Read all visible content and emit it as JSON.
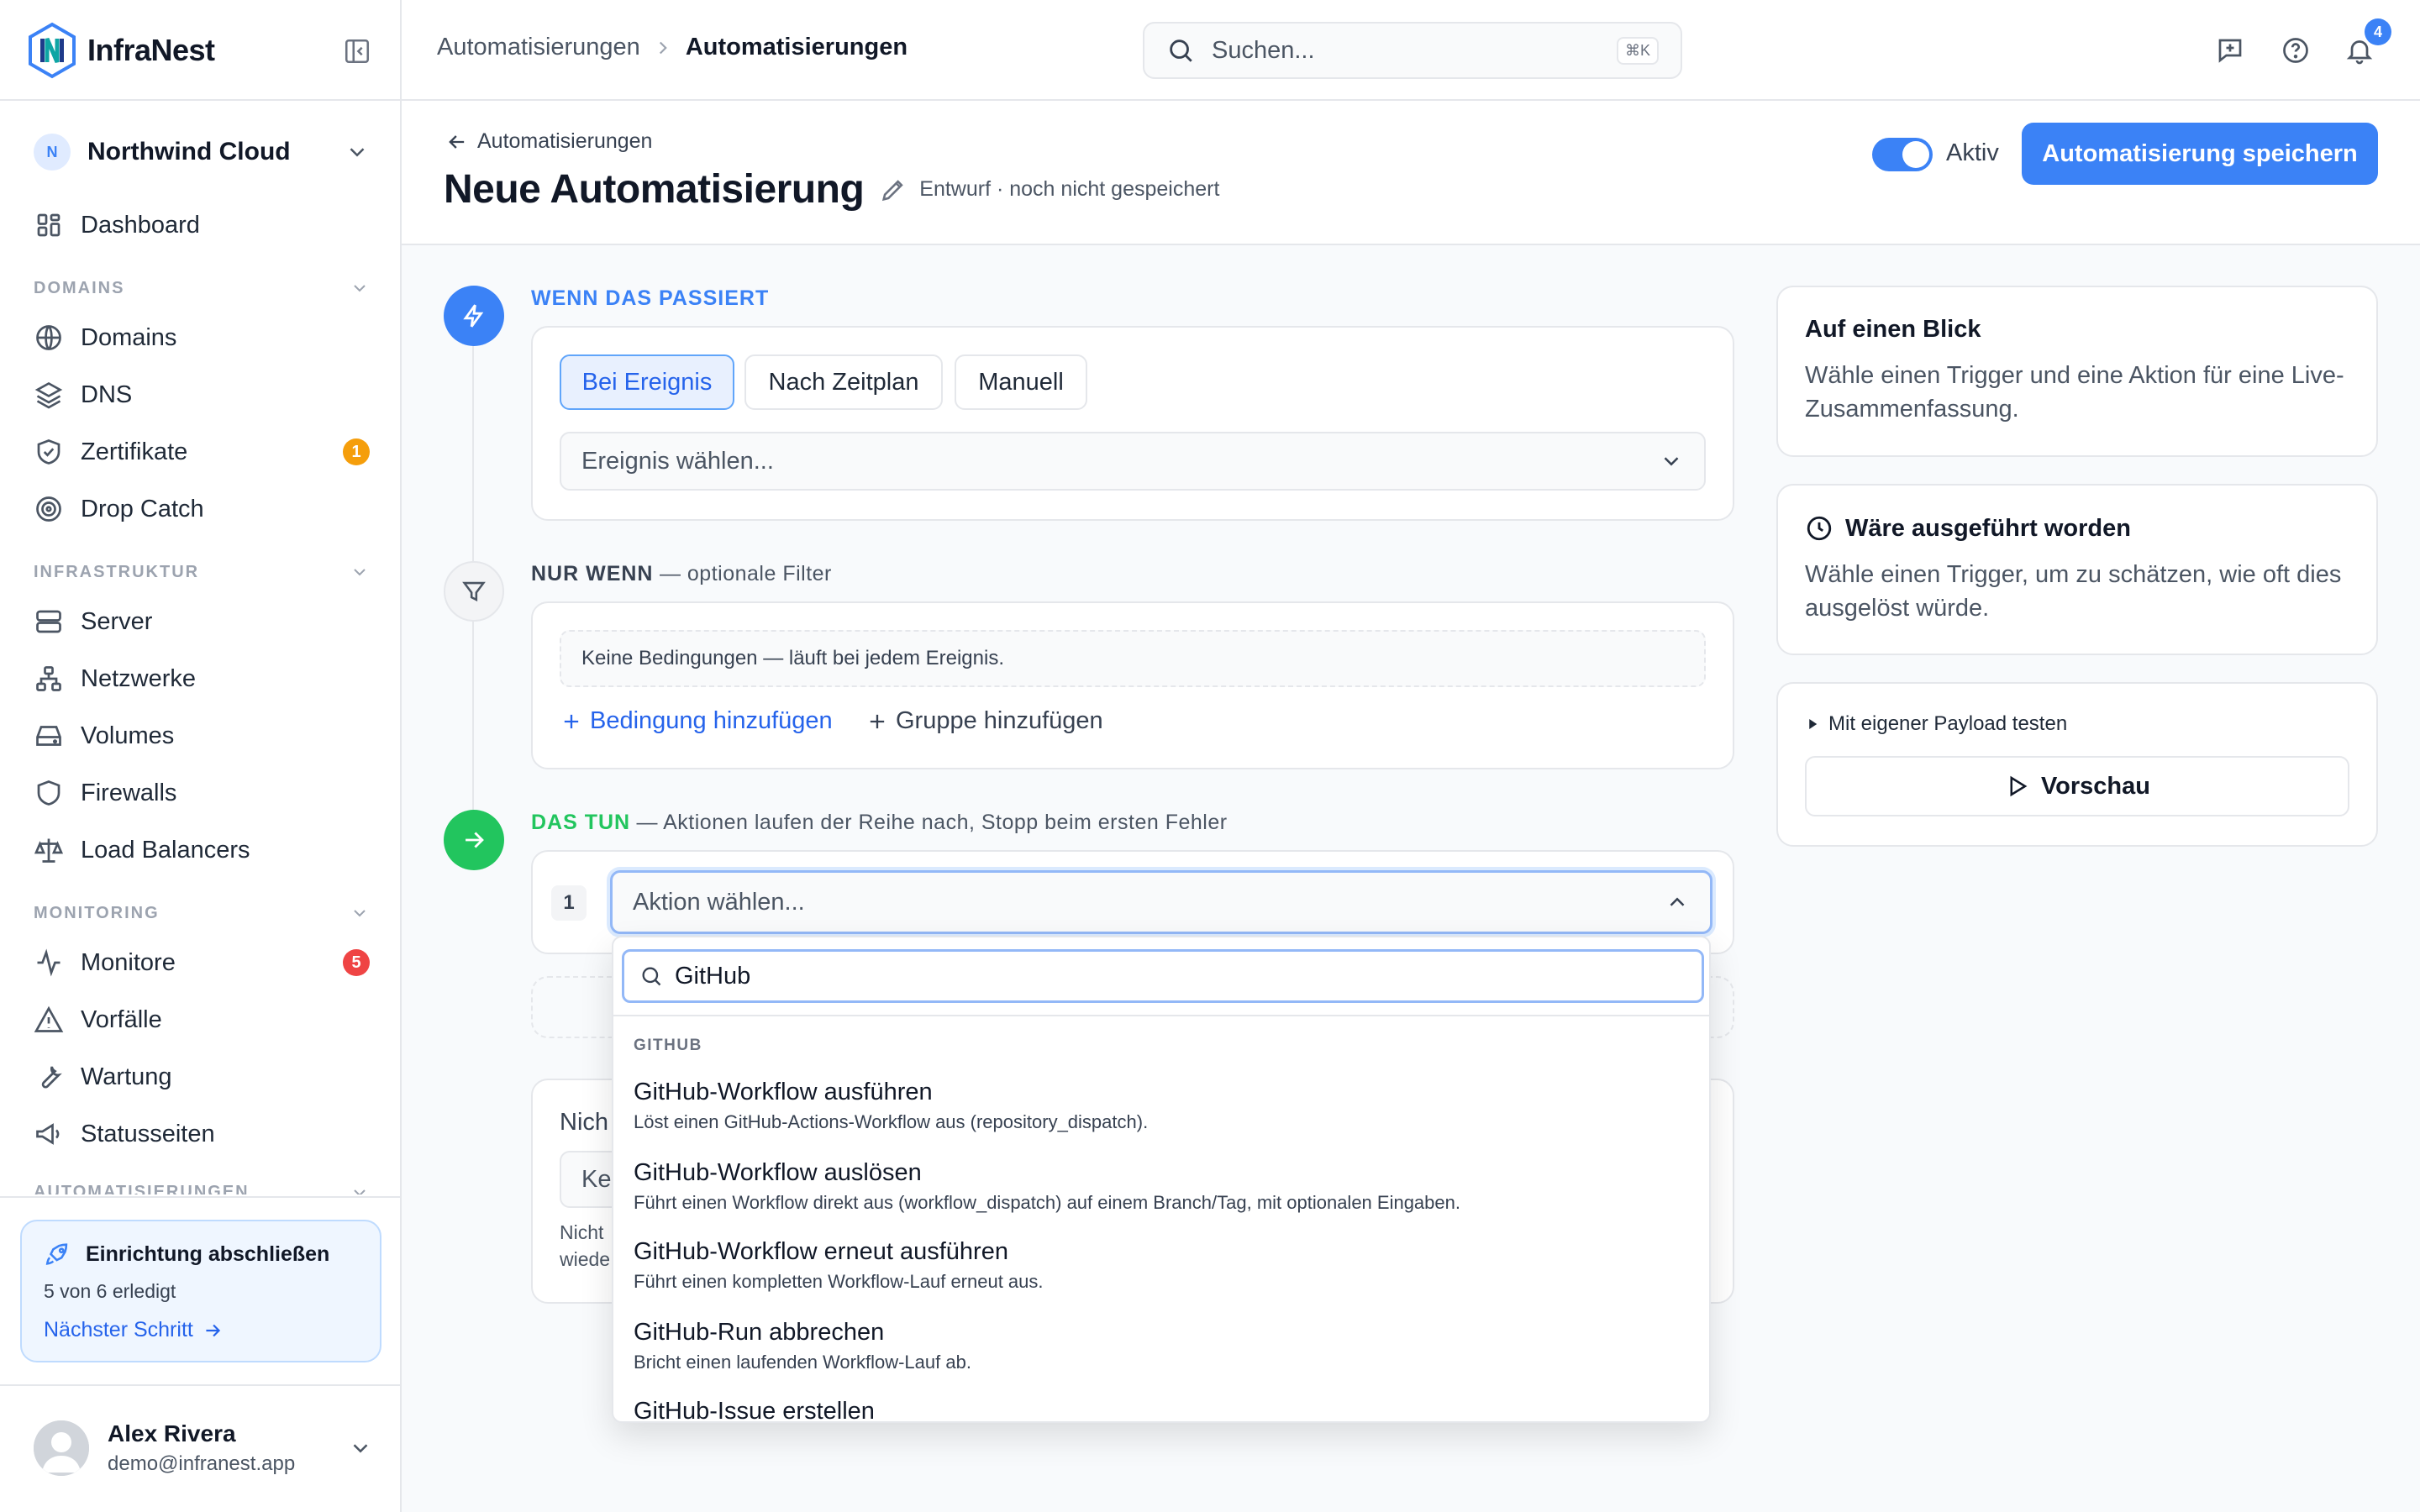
{
  "app": {
    "name": "InfraNest"
  },
  "org": {
    "avatar_letter": "N",
    "name": "Northwind Cloud"
  },
  "sidebar": {
    "dashboard": "Dashboard",
    "sections": [
      {
        "title": "DOMAINS",
        "items": [
          {
            "label": "Domains",
            "icon": "globe-icon"
          },
          {
            "label": "DNS",
            "icon": "layers-icon"
          },
          {
            "label": "Zertifikate",
            "icon": "shield-check-icon",
            "badge": "1",
            "badge_color": "#f59e0b"
          },
          {
            "label": "Drop Catch",
            "icon": "target-icon"
          }
        ]
      },
      {
        "title": "INFRASTRUKTUR",
        "items": [
          {
            "label": "Server",
            "icon": "server-icon"
          },
          {
            "label": "Netzwerke",
            "icon": "network-icon"
          },
          {
            "label": "Volumes",
            "icon": "drive-icon"
          },
          {
            "label": "Firewalls",
            "icon": "shield-icon"
          },
          {
            "label": "Load Balancers",
            "icon": "scale-icon"
          }
        ]
      },
      {
        "title": "MONITORING",
        "items": [
          {
            "label": "Monitore",
            "icon": "activity-icon",
            "badge": "5",
            "badge_color": "#ef4444"
          },
          {
            "label": "Vorfälle",
            "icon": "alert-triangle-icon"
          },
          {
            "label": "Wartung",
            "icon": "wrench-icon"
          },
          {
            "label": "Statusseiten",
            "icon": "megaphone-icon"
          }
        ]
      },
      {
        "title": "AUTOMATISIERUNGEN"
      }
    ],
    "setup": {
      "title": "Einrichtung abschließen",
      "progress": "5 von 6 erledigt",
      "link": "Nächster Schritt"
    },
    "user": {
      "name": "Alex Rivera",
      "email": "demo@infranest.app"
    }
  },
  "topbar": {
    "breadcrumb": [
      "Automatisierungen",
      "Automatisierungen"
    ],
    "search_placeholder": "Suchen...",
    "search_shortcut": "⌘K",
    "notification_count": "4"
  },
  "page": {
    "back_label": "Automatisierungen",
    "title": "Neue Automatisierung",
    "status": "Entwurf · noch nicht gespeichert",
    "active_label": "Aktiv",
    "active": true,
    "save_label": "Automatisierung speichern"
  },
  "trigger": {
    "title": "WENN DAS PASSIERT",
    "modes": [
      "Bei Ereignis",
      "Nach Zeitplan",
      "Manuell"
    ],
    "active_mode": "Bei Ereignis",
    "event_placeholder": "Ereignis wählen..."
  },
  "filter": {
    "title": "NUR WENN",
    "subtitle": " — optionale Filter",
    "empty": "Keine Bedingungen — läuft bei jedem Ereignis.",
    "add_condition": "Bedingung hinzufügen",
    "add_group": "Gruppe hinzufügen"
  },
  "actions": {
    "title": "DAS TUN",
    "subtitle": " — Aktionen laufen der Reihe nach, Stopp beim ersten Fehler",
    "step_number": "1",
    "action_placeholder": "Aktion wählen...",
    "hidden_fragments": [
      "Nich",
      "Ke",
      "Nicht",
      "wiede"
    ]
  },
  "dropdown": {
    "search_value": "GitHub",
    "group": "GITHUB",
    "options": [
      {
        "title": "GitHub-Workflow ausführen",
        "desc": "Löst einen GitHub-Actions-Workflow aus (repository_dispatch)."
      },
      {
        "title": "GitHub-Workflow auslösen",
        "desc": "Führt einen Workflow direkt aus (workflow_dispatch) auf einem Branch/Tag, mit optionalen Eingaben."
      },
      {
        "title": "GitHub-Workflow erneut ausführen",
        "desc": "Führt einen kompletten Workflow-Lauf erneut aus."
      },
      {
        "title": "GitHub-Run abbrechen",
        "desc": "Bricht einen laufenden Workflow-Lauf ab."
      },
      {
        "title": "GitHub-Issue erstellen",
        "desc": ""
      }
    ]
  },
  "right": {
    "glance": {
      "title": "Auf einen Blick",
      "body": "Wähle einen Trigger und eine Aktion für eine Live-Zusammenfassung."
    },
    "would_run": {
      "title": "Wäre ausgeführt worden",
      "body": "Wähle einen Trigger, um zu schätzen, wie oft dies ausgelöst würde."
    },
    "payload": {
      "toggle": "Mit eigener Payload testen",
      "preview": "Vorschau"
    }
  },
  "colors": {
    "accent": "#3b82f6",
    "success": "#22c55e",
    "warning": "#f59e0b",
    "danger": "#ef4444"
  }
}
